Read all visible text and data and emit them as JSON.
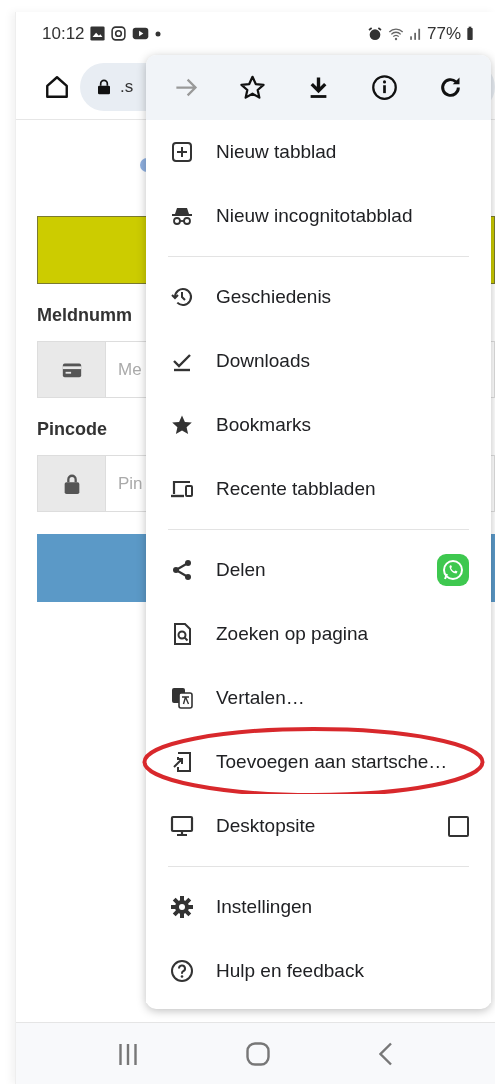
{
  "status_bar": {
    "time": "10:12",
    "battery": "77%"
  },
  "browser_toolbar": {
    "url": ".s"
  },
  "page": {
    "fields": [
      {
        "label": "Meldnumm",
        "placeholder": "Me"
      },
      {
        "label": "Pincode",
        "placeholder": "Pin"
      }
    ]
  },
  "menu": {
    "toolbar": [
      {
        "disabled": true
      },
      {
        "disabled": false
      },
      {
        "disabled": false
      },
      {
        "disabled": false
      },
      {
        "disabled": false
      }
    ],
    "sections": [
      [
        {
          "label": "Nieuw tabblad",
          "kind": "action",
          "highlighted": false
        },
        {
          "label": "Nieuw incognitotabblad",
          "kind": "action",
          "highlighted": false
        }
      ],
      [
        {
          "label": "Geschiedenis",
          "kind": "action",
          "highlighted": false
        },
        {
          "label": "Downloads",
          "kind": "action",
          "highlighted": false
        },
        {
          "label": "Bookmarks",
          "kind": "action",
          "highlighted": false
        },
        {
          "label": "Recente tabbladen",
          "kind": "action",
          "highlighted": false
        }
      ],
      [
        {
          "label": "Delen",
          "kind": "share",
          "highlighted": false
        },
        {
          "label": "Zoeken op pagina",
          "kind": "action",
          "highlighted": false
        },
        {
          "label": "Vertalen…",
          "kind": "action",
          "highlighted": false
        },
        {
          "label": "Toevoegen aan startsche…",
          "kind": "action",
          "highlighted": true
        },
        {
          "label": "Desktopsite",
          "kind": "toggle",
          "checked": false,
          "highlighted": false
        }
      ],
      [
        {
          "label": "Instellingen",
          "kind": "action",
          "highlighted": false
        },
        {
          "label": "Hulp en feedback",
          "kind": "action",
          "highlighted": false
        }
      ]
    ]
  }
}
